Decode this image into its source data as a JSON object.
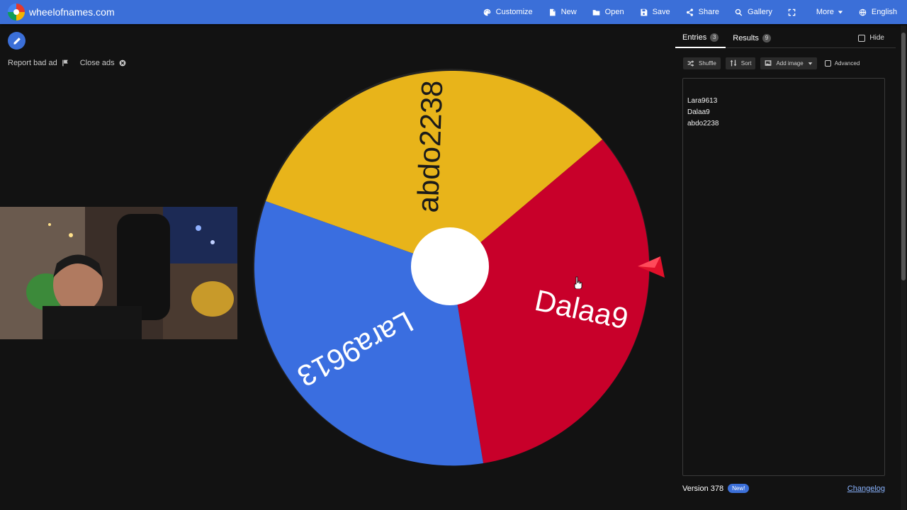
{
  "header": {
    "site_name": "wheelofnames.com",
    "nav": [
      {
        "label": "Customize",
        "icon": "palette-icon"
      },
      {
        "label": "New",
        "icon": "file-icon"
      },
      {
        "label": "Open",
        "icon": "folder-icon"
      },
      {
        "label": "Save",
        "icon": "save-icon"
      },
      {
        "label": "Share",
        "icon": "share-icon"
      },
      {
        "label": "Gallery",
        "icon": "search-icon"
      },
      {
        "label": "",
        "icon": "fullscreen-icon"
      },
      {
        "label": "More",
        "icon": "chevron-down-icon"
      },
      {
        "label": "English",
        "icon": "globe-icon"
      }
    ]
  },
  "ads": {
    "report_label": "Report bad ad",
    "close_label": "Close ads"
  },
  "wheel": {
    "segments": [
      {
        "label": "abdo2238",
        "color": "#e8b41a"
      },
      {
        "label": "Dalaa9",
        "color": "#c8002a"
      },
      {
        "label": "Lara9613",
        "color": "#3a6ee0"
      }
    ],
    "center_color": "#ffffff",
    "pointer_color": "#e0102a"
  },
  "panel": {
    "tabs": [
      {
        "label": "Entries",
        "count": "3"
      },
      {
        "label": "Results",
        "count": "9"
      }
    ],
    "hide_label": "Hide",
    "toolbar": {
      "shuffle": "Shuffle",
      "sort": "Sort",
      "add_image": "Add image",
      "advanced": "Advanced"
    },
    "entries": [
      "Lara9613",
      "Dalaa9",
      "abdo2238"
    ],
    "version": "Version 378",
    "new_badge": "New!",
    "changelog": "Changelog"
  },
  "colors": {
    "topbar": "#3b6fd8",
    "background": "#121212"
  }
}
